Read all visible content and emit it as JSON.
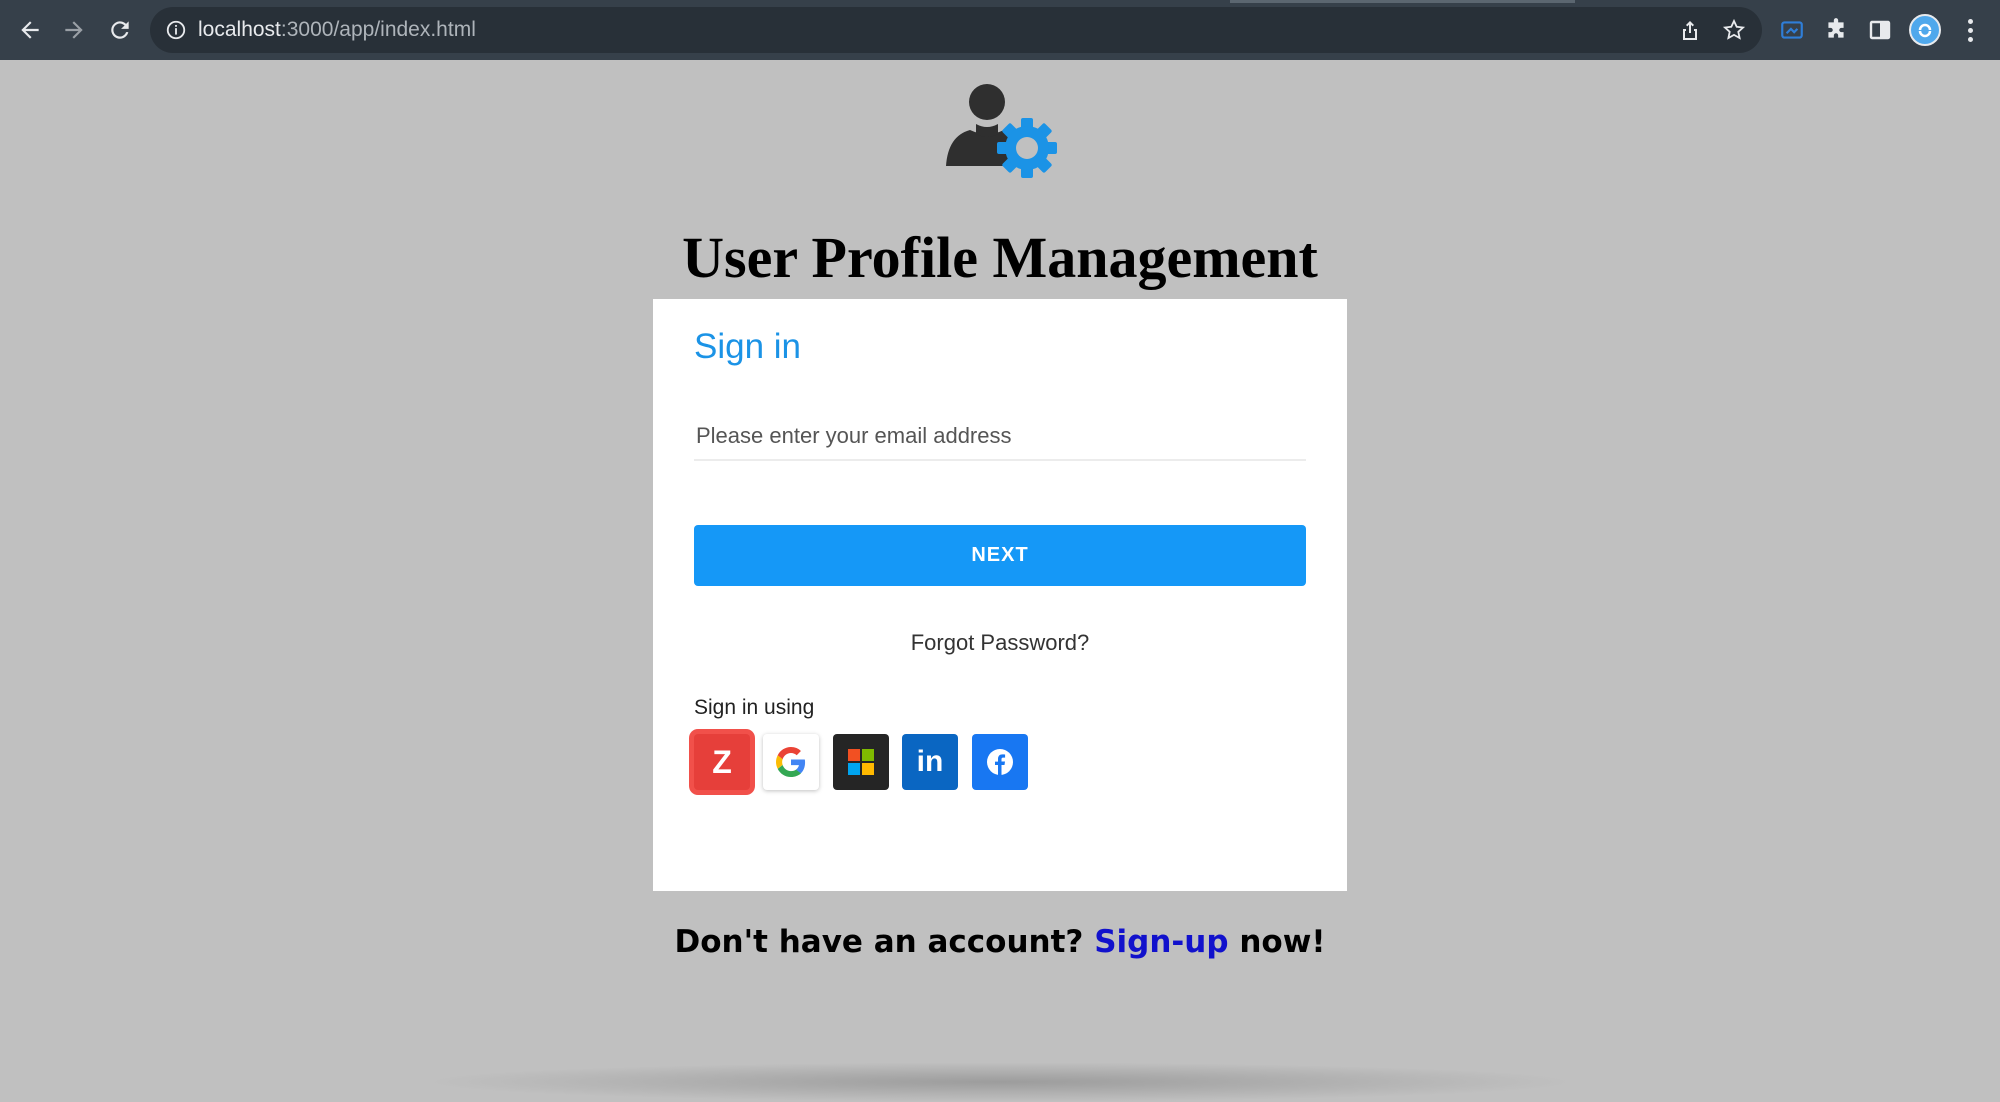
{
  "browser": {
    "url_host": "localhost",
    "url_path": ":3000/app/index.html",
    "icons": [
      "back-icon",
      "forward-icon",
      "reload-icon",
      "site-info-icon",
      "share-icon",
      "bookmark-star-icon",
      "extension-icon",
      "puzzle-icon",
      "side-panel-icon",
      "profile-icon",
      "menu-icon"
    ]
  },
  "page": {
    "title": "User Profile Management",
    "logo_icon": "user-settings-icon",
    "card": {
      "heading": "Sign in",
      "email_placeholder": "Please enter your email address",
      "next_label": "NEXT",
      "forgot_label": "Forgot Password?",
      "sign_in_using": "Sign in using",
      "providers": [
        {
          "name": "zoho",
          "glyph": "Z"
        },
        {
          "name": "google",
          "glyph": "G"
        },
        {
          "name": "microsoft",
          "glyph": ""
        },
        {
          "name": "linkedin",
          "glyph": "in"
        },
        {
          "name": "facebook",
          "glyph": "f"
        }
      ]
    },
    "signup": {
      "prefix": "Don't have an account? ",
      "link": "Sign-up",
      "suffix": " now!"
    }
  },
  "colors": {
    "accent": "#1598f7",
    "heading_blue": "#1b93e6",
    "zoho": "#e63f3a",
    "linkedin": "#0a66c2",
    "facebook": "#1877f2",
    "page_bg": "#c0c0c0"
  }
}
